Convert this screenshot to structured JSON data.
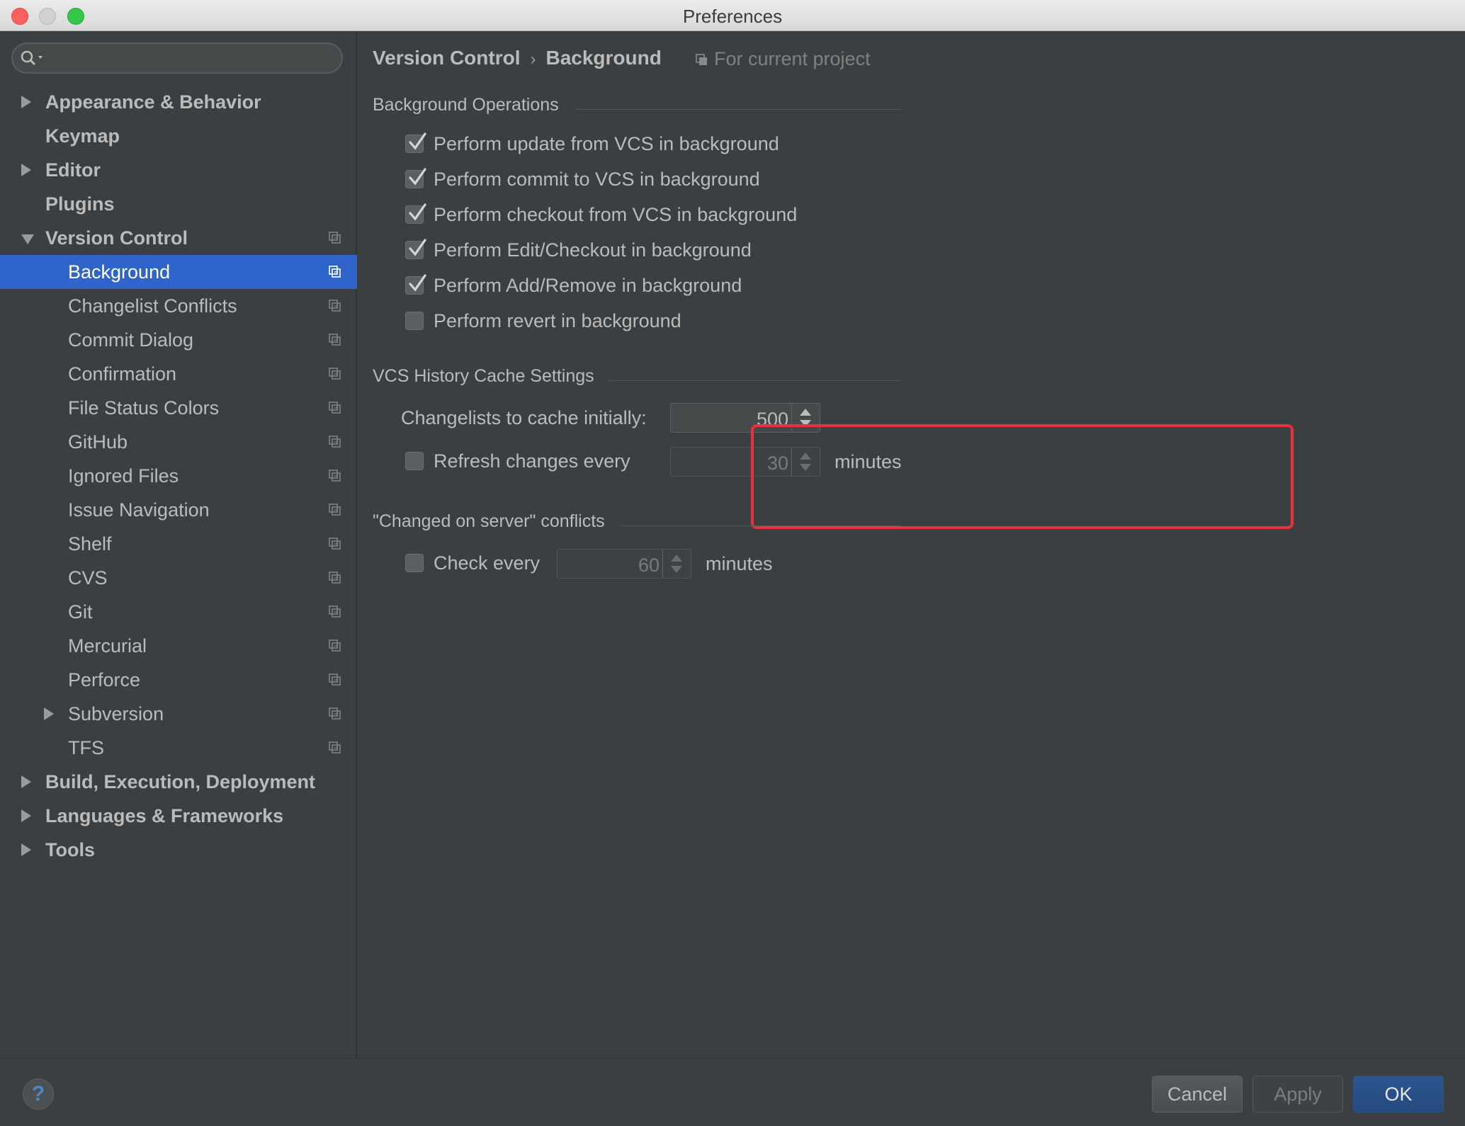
{
  "window": {
    "title": "Preferences"
  },
  "search": {
    "placeholder": ""
  },
  "sidebar": {
    "items": [
      {
        "label": "Appearance & Behavior",
        "level": 0,
        "expander": "collapsed",
        "bold": true,
        "project_icon": false
      },
      {
        "label": "Keymap",
        "level": 0,
        "expander": "none",
        "bold": true,
        "project_icon": false
      },
      {
        "label": "Editor",
        "level": 0,
        "expander": "collapsed",
        "bold": true,
        "project_icon": false
      },
      {
        "label": "Plugins",
        "level": 0,
        "expander": "none",
        "bold": true,
        "project_icon": false
      },
      {
        "label": "Version Control",
        "level": 0,
        "expander": "expanded",
        "bold": true,
        "project_icon": true
      },
      {
        "label": "Background",
        "level": 1,
        "expander": "none",
        "bold": false,
        "project_icon": true,
        "selected": true
      },
      {
        "label": "Changelist Conflicts",
        "level": 1,
        "expander": "none",
        "bold": false,
        "project_icon": true
      },
      {
        "label": "Commit Dialog",
        "level": 1,
        "expander": "none",
        "bold": false,
        "project_icon": true
      },
      {
        "label": "Confirmation",
        "level": 1,
        "expander": "none",
        "bold": false,
        "project_icon": true
      },
      {
        "label": "File Status Colors",
        "level": 1,
        "expander": "none",
        "bold": false,
        "project_icon": true
      },
      {
        "label": "GitHub",
        "level": 1,
        "expander": "none",
        "bold": false,
        "project_icon": true
      },
      {
        "label": "Ignored Files",
        "level": 1,
        "expander": "none",
        "bold": false,
        "project_icon": true
      },
      {
        "label": "Issue Navigation",
        "level": 1,
        "expander": "none",
        "bold": false,
        "project_icon": true
      },
      {
        "label": "Shelf",
        "level": 1,
        "expander": "none",
        "bold": false,
        "project_icon": true
      },
      {
        "label": "CVS",
        "level": 1,
        "expander": "none",
        "bold": false,
        "project_icon": true
      },
      {
        "label": "Git",
        "level": 1,
        "expander": "none",
        "bold": false,
        "project_icon": true
      },
      {
        "label": "Mercurial",
        "level": 1,
        "expander": "none",
        "bold": false,
        "project_icon": true
      },
      {
        "label": "Perforce",
        "level": 1,
        "expander": "none",
        "bold": false,
        "project_icon": true
      },
      {
        "label": "Subversion",
        "level": 1,
        "expander": "collapsed",
        "bold": false,
        "project_icon": true
      },
      {
        "label": "TFS",
        "level": 1,
        "expander": "none",
        "bold": false,
        "project_icon": true
      },
      {
        "label": "Build, Execution, Deployment",
        "level": 0,
        "expander": "collapsed",
        "bold": true,
        "project_icon": false
      },
      {
        "label": "Languages & Frameworks",
        "level": 0,
        "expander": "collapsed",
        "bold": true,
        "project_icon": false
      },
      {
        "label": "Tools",
        "level": 0,
        "expander": "collapsed",
        "bold": true,
        "project_icon": false
      }
    ]
  },
  "breadcrumb": {
    "parent": "Version Control",
    "separator": "›",
    "current": "Background",
    "scope": "For current project"
  },
  "background_operations": {
    "title": "Background Operations",
    "options": [
      {
        "label": "Perform update from VCS in background",
        "checked": true
      },
      {
        "label": "Perform commit to VCS in background",
        "checked": true
      },
      {
        "label": "Perform checkout from VCS in background",
        "checked": true
      },
      {
        "label": "Perform Edit/Checkout in background",
        "checked": true
      },
      {
        "label": "Perform Add/Remove in background",
        "checked": true
      },
      {
        "label": "Perform revert in background",
        "checked": false
      }
    ]
  },
  "history_cache": {
    "title": "VCS History Cache Settings",
    "changelists_label": "Changelists to cache initially:",
    "changelists_value": "500",
    "refresh_label": "Refresh changes every",
    "refresh_checked": false,
    "refresh_value": "30",
    "refresh_unit": "minutes"
  },
  "server_conflicts": {
    "title": "\"Changed on server\" conflicts",
    "check_label": "Check every",
    "check_checked": false,
    "check_value": "60",
    "check_unit": "minutes"
  },
  "footer": {
    "help": "?",
    "cancel": "Cancel",
    "apply": "Apply",
    "ok": "OK"
  },
  "colors": {
    "accent": "#2f65ca",
    "highlight_box": "#e8303f",
    "background": "#3c3f41"
  }
}
